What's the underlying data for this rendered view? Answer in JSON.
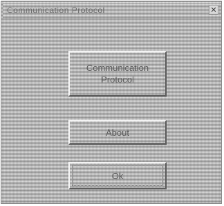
{
  "window": {
    "title": "Communication Protocol",
    "close_glyph": "✕"
  },
  "buttons": {
    "protocol_label": "Communication Protocol",
    "about_label": "About",
    "ok_label": "Ok"
  },
  "colors": {
    "face": "#c8c8c8",
    "text": "#5a5a5a",
    "highlight": "#f4f4f4",
    "shadow": "#5c5c5c"
  },
  "icons": {
    "close": "close-icon"
  }
}
